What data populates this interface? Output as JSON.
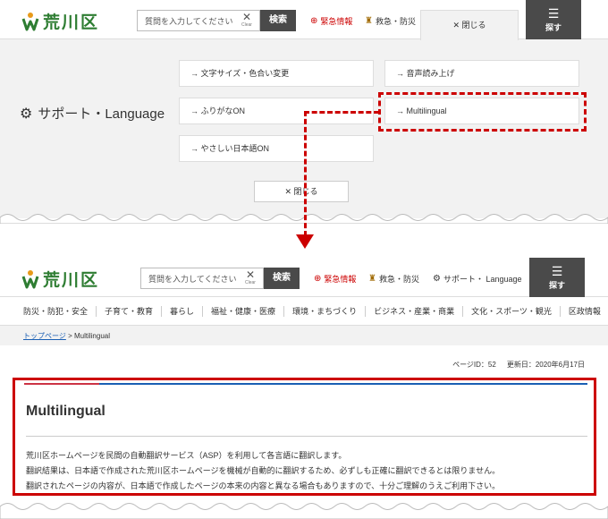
{
  "header": {
    "logo_text": "荒川区",
    "search_placeholder": "質問を入力してください",
    "clear_label": "Clear",
    "search_button": "検索",
    "emergency": "緊急情報",
    "rescue": "救急・防災",
    "close_tab": "閉じる",
    "sagasu": "探す"
  },
  "support_panel": {
    "title": "サポート・Language",
    "options": [
      "文字サイズ・色合い変更",
      "音声読み上げ",
      "ふりがなON",
      "Multilingual",
      "やさしい日本語ON"
    ],
    "close_button": "閉じる"
  },
  "header2": {
    "support_link": "サポート・ Language"
  },
  "nav": {
    "items": [
      "防災・防犯・安全",
      "子育て・教育",
      "暮らし",
      "福祉・健康・医療",
      "環境・まちづくり",
      "ビジネス・産業・商業",
      "文化・スポーツ・観光",
      "区政情報"
    ]
  },
  "breadcrumb": {
    "home": "トップページ",
    "sep": " > ",
    "current": "Multilingual"
  },
  "meta": {
    "page_id": "ページID：52",
    "updated": "更新日：2020年6月17日"
  },
  "content": {
    "title": "Multilingual",
    "lines": [
      "荒川区ホームページを民間の自動翻訳サービス（ASP）を利用して各言語に翻訳します。",
      "翻訳結果は、日本語で作成された荒川区ホームページを機械が自動的に翻訳するため、必ずしも正確に翻訳できるとは限りません。",
      "翻訳されたページの内容が、日本語で作成したページの本来の内容と異なる場合もありますので、十分ご理解のうえご利用下さい。"
    ]
  },
  "colors": {
    "highlight": "#cc0000",
    "brand_green": "#2e7d32",
    "dark_button": "#4a4a4a",
    "link_blue": "#1a5fb4"
  }
}
